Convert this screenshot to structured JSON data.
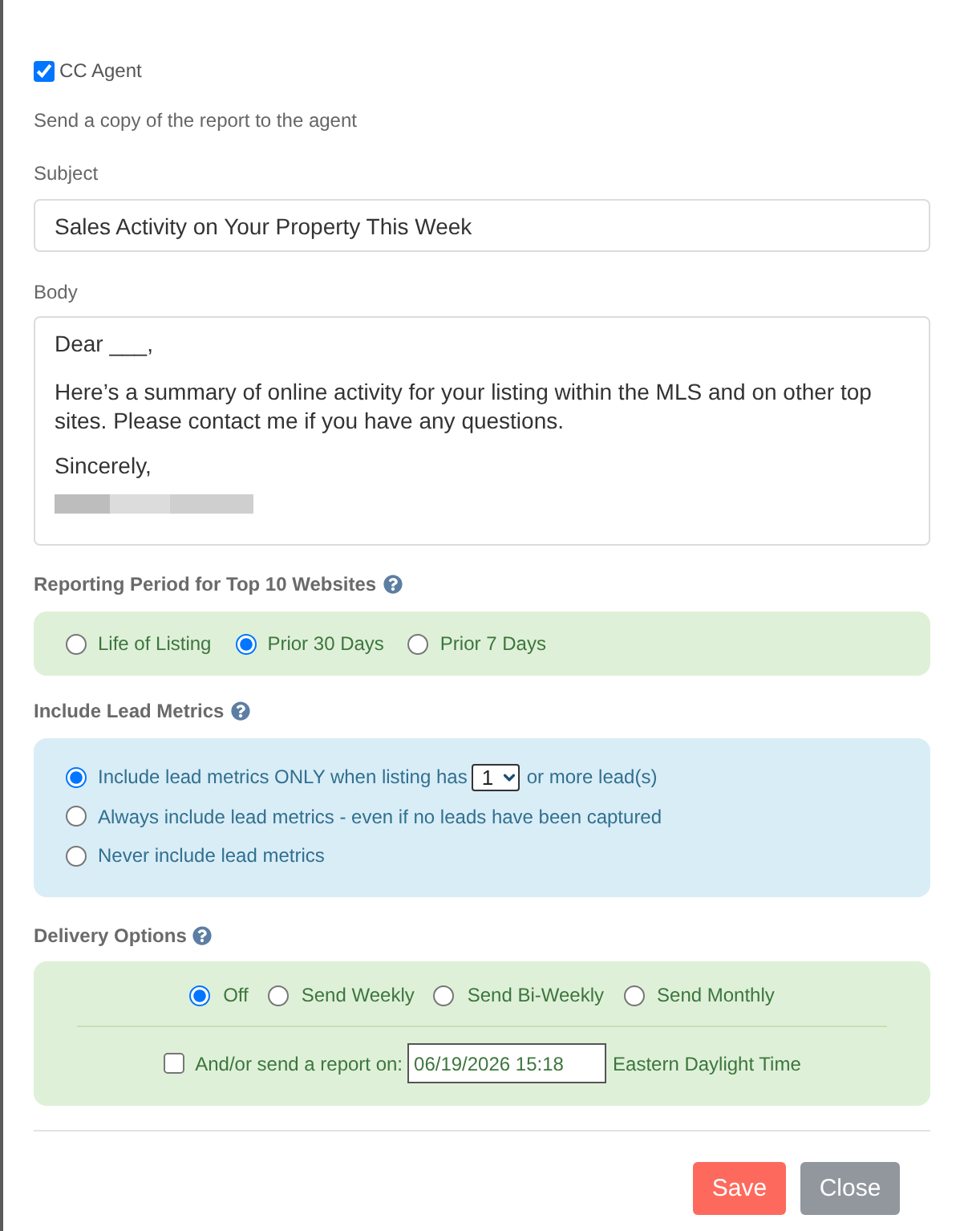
{
  "cc_agent": {
    "label": "CC Agent",
    "checked": true,
    "hint": "Send a copy of the report to the agent"
  },
  "subject": {
    "label": "Subject",
    "value": "Sales Activity on Your Property This Week"
  },
  "body": {
    "label": "Body",
    "paragraphs": [
      "Dear ___,",
      "Here’s a summary of online activity for your listing within the MLS and on other top sites. Please contact me if you have any questions.",
      "Sincerely,"
    ]
  },
  "reporting_period": {
    "label": "Reporting Period for Top 10 Websites",
    "options": [
      {
        "label": "Life of Listing",
        "selected": false
      },
      {
        "label": "Prior 30 Days",
        "selected": true
      },
      {
        "label": "Prior 7 Days",
        "selected": false
      }
    ]
  },
  "lead_metrics": {
    "label": "Include Lead Metrics",
    "options": [
      {
        "kind": "threshold",
        "label_before": "Include lead metrics ONLY when listing has",
        "select_value": "1",
        "label_after": "or more lead(s)",
        "selected": true
      },
      {
        "kind": "plain",
        "label": "Always include lead metrics - even if no leads have been captured",
        "selected": false
      },
      {
        "kind": "plain",
        "label": "Never include lead metrics",
        "selected": false
      }
    ]
  },
  "delivery": {
    "label": "Delivery Options",
    "frequency": [
      {
        "label": "Off",
        "selected": true
      },
      {
        "label": "Send Weekly",
        "selected": false
      },
      {
        "label": "Send Bi-Weekly",
        "selected": false
      },
      {
        "label": "Send Monthly",
        "selected": false
      }
    ],
    "schedule": {
      "label": "And/or send a report on:",
      "checked": false,
      "value": "06/19/2026 15:18",
      "timezone": "Eastern Daylight Time"
    }
  },
  "buttons": [
    {
      "kind": "primary",
      "label": "Save"
    },
    {
      "kind": "secondary",
      "label": "Close"
    }
  ]
}
